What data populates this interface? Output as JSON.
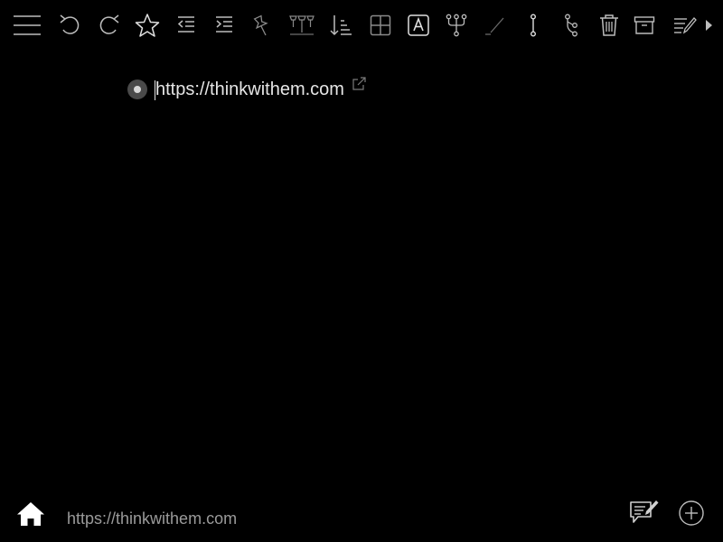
{
  "toolbar": {
    "icons": [
      "menu-icon",
      "undo-icon",
      "redo-icon",
      "star-icon",
      "outdent-icon",
      "indent-icon",
      "pin-icon",
      "multi-pin-icon",
      "sort-icon",
      "grid-icon",
      "text-style-icon",
      "branch-icon",
      "pencil-icon",
      "link-icon",
      "connect-icon",
      "trash-icon",
      "archive-icon",
      "notes-icon",
      "more-arrow-icon"
    ]
  },
  "outline": {
    "node": {
      "text": "https://thinkwithem.com"
    }
  },
  "bottom": {
    "breadcrumb": "https://thinkwithem.com"
  },
  "colors": {
    "background": "#000000",
    "icon": "#bdbdbd",
    "text": "#e6e6e6",
    "muted_text": "#9a9a9a",
    "bullet": "#4a4a4a"
  }
}
